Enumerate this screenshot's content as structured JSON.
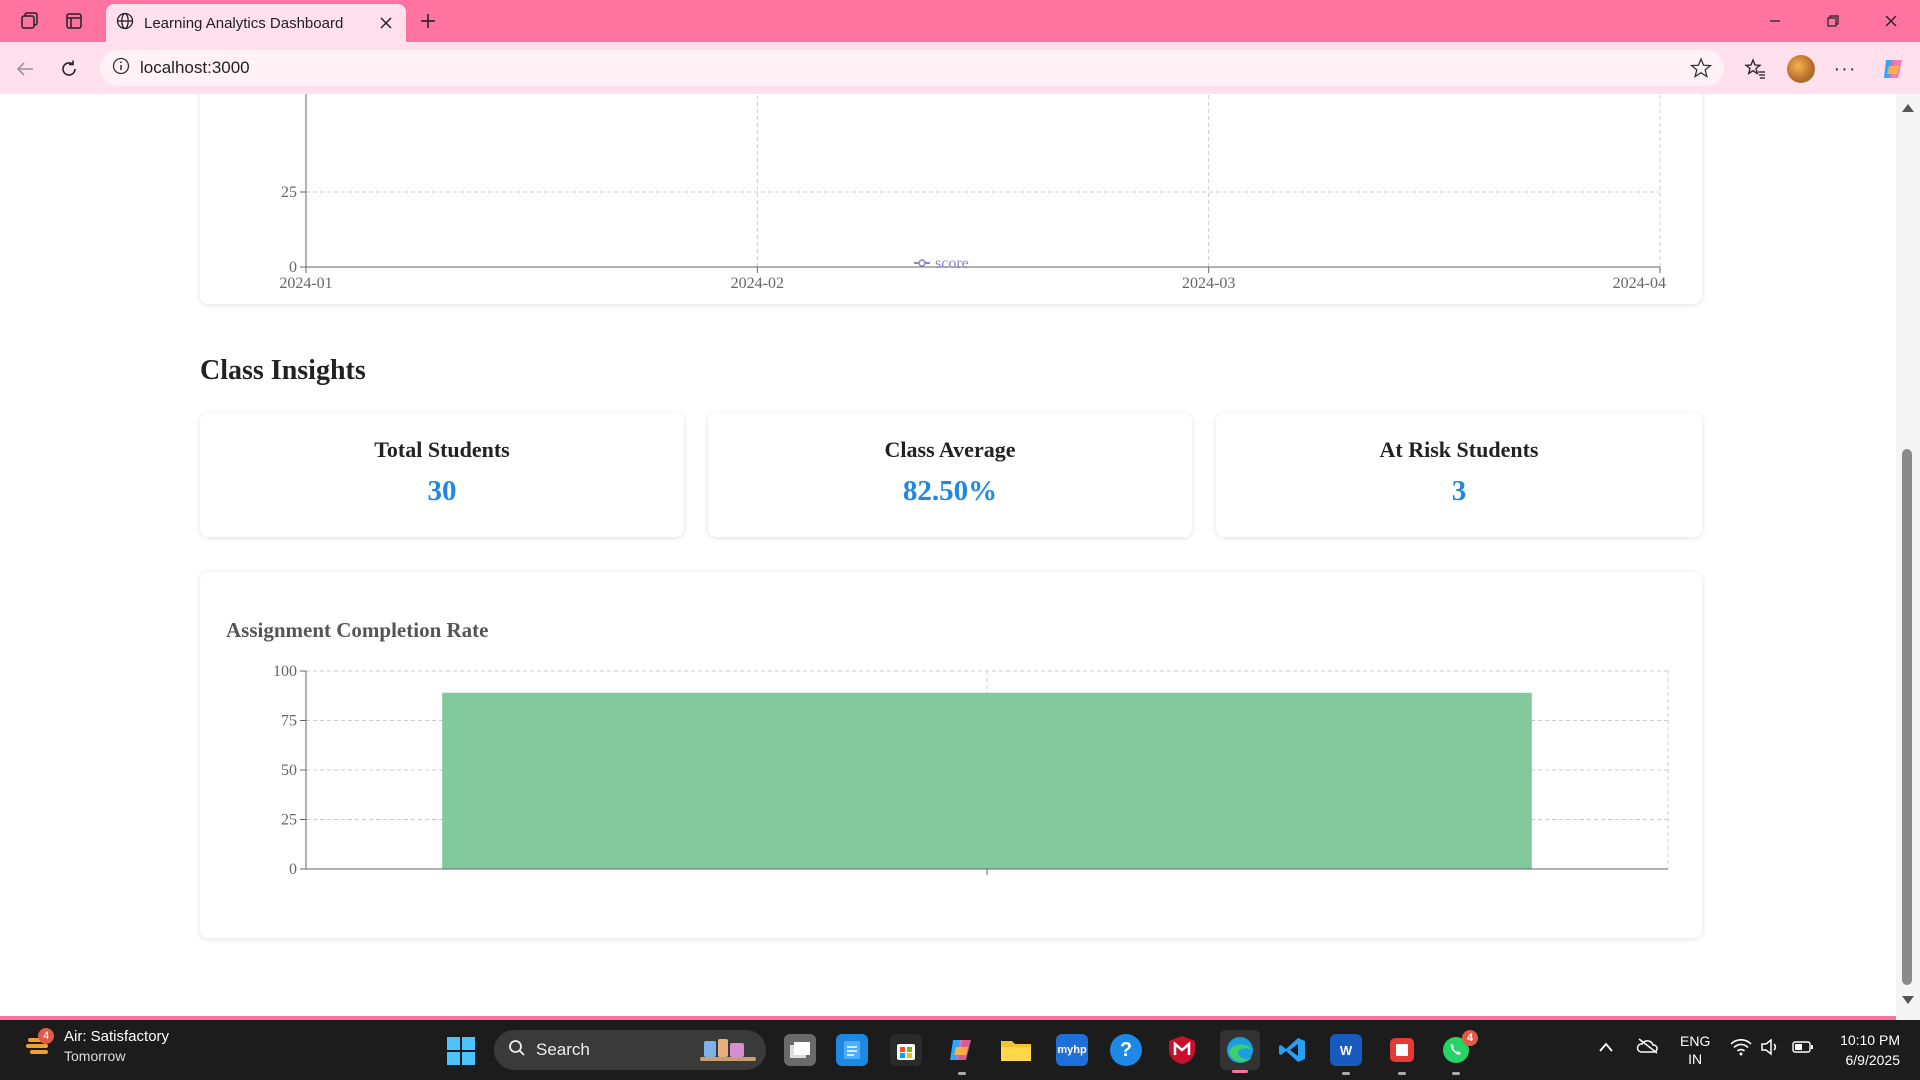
{
  "browser": {
    "tab_title": "Learning Analytics Dashboard",
    "url": "localhost:3000"
  },
  "page": {
    "top_chart": {
      "chart_data": {
        "type": "line",
        "x_ticks": [
          "2024-01",
          "2024-02",
          "2024-03",
          "2024-04"
        ],
        "y_ticks_visible": [
          "0",
          "25"
        ],
        "legend": [
          "score"
        ],
        "legend_color": "#8884d8",
        "grid": true
      }
    },
    "section_title": "Class Insights",
    "stats": [
      {
        "label": "Total Students",
        "value": "30"
      },
      {
        "label": "Class Average",
        "value": "82.50%"
      },
      {
        "label": "At Risk Students",
        "value": "3"
      }
    ],
    "completion_chart": {
      "title": "Assignment Completion Rate",
      "chart_data": {
        "type": "bar",
        "categories": [
          ""
        ],
        "values": [
          89
        ],
        "ylim": [
          0,
          100
        ],
        "y_ticks": [
          "0",
          "25",
          "50",
          "75",
          "100"
        ],
        "bar_color": "#82ca9d",
        "grid": true
      }
    }
  },
  "taskbar": {
    "weather_badge": "4",
    "weather_line1": "Air: Satisfactory",
    "weather_line2": "Tomorrow",
    "search_placeholder": "Search",
    "lang_line1": "ENG",
    "lang_line2": "IN",
    "time": "10:10 PM",
    "date": "6/9/2025",
    "whatsapp_badge": "4"
  }
}
